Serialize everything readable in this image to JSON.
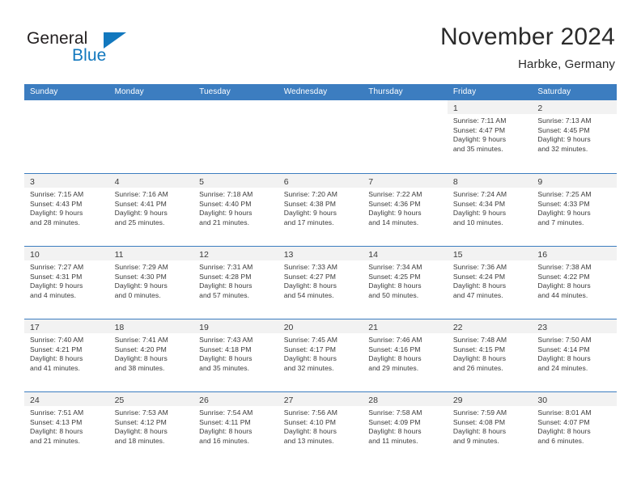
{
  "brand": {
    "name_part1": "General",
    "name_part2": "Blue",
    "triangle_color": "#1278be",
    "text_color": "#231f20"
  },
  "header": {
    "title": "November 2024",
    "subtitle": "Harbke, Germany"
  },
  "theme": {
    "header_blue": "#3c7dc0",
    "daynum_strip": "#f2f2f2",
    "text": "#3a3a3a"
  },
  "weekdays": [
    "Sunday",
    "Monday",
    "Tuesday",
    "Wednesday",
    "Thursday",
    "Friday",
    "Saturday"
  ],
  "weeks": [
    [
      {
        "day": "",
        "lines": [
          "",
          "",
          "",
          ""
        ]
      },
      {
        "day": "",
        "lines": [
          "",
          "",
          "",
          ""
        ]
      },
      {
        "day": "",
        "lines": [
          "",
          "",
          "",
          ""
        ]
      },
      {
        "day": "",
        "lines": [
          "",
          "",
          "",
          ""
        ]
      },
      {
        "day": "",
        "lines": [
          "",
          "",
          "",
          ""
        ]
      },
      {
        "day": "1",
        "lines": [
          "Sunrise: 7:11 AM",
          "Sunset: 4:47 PM",
          "Daylight: 9 hours",
          "and 35 minutes."
        ]
      },
      {
        "day": "2",
        "lines": [
          "Sunrise: 7:13 AM",
          "Sunset: 4:45 PM",
          "Daylight: 9 hours",
          "and 32 minutes."
        ]
      }
    ],
    [
      {
        "day": "3",
        "lines": [
          "Sunrise: 7:15 AM",
          "Sunset: 4:43 PM",
          "Daylight: 9 hours",
          "and 28 minutes."
        ]
      },
      {
        "day": "4",
        "lines": [
          "Sunrise: 7:16 AM",
          "Sunset: 4:41 PM",
          "Daylight: 9 hours",
          "and 25 minutes."
        ]
      },
      {
        "day": "5",
        "lines": [
          "Sunrise: 7:18 AM",
          "Sunset: 4:40 PM",
          "Daylight: 9 hours",
          "and 21 minutes."
        ]
      },
      {
        "day": "6",
        "lines": [
          "Sunrise: 7:20 AM",
          "Sunset: 4:38 PM",
          "Daylight: 9 hours",
          "and 17 minutes."
        ]
      },
      {
        "day": "7",
        "lines": [
          "Sunrise: 7:22 AM",
          "Sunset: 4:36 PM",
          "Daylight: 9 hours",
          "and 14 minutes."
        ]
      },
      {
        "day": "8",
        "lines": [
          "Sunrise: 7:24 AM",
          "Sunset: 4:34 PM",
          "Daylight: 9 hours",
          "and 10 minutes."
        ]
      },
      {
        "day": "9",
        "lines": [
          "Sunrise: 7:25 AM",
          "Sunset: 4:33 PM",
          "Daylight: 9 hours",
          "and 7 minutes."
        ]
      }
    ],
    [
      {
        "day": "10",
        "lines": [
          "Sunrise: 7:27 AM",
          "Sunset: 4:31 PM",
          "Daylight: 9 hours",
          "and 4 minutes."
        ]
      },
      {
        "day": "11",
        "lines": [
          "Sunrise: 7:29 AM",
          "Sunset: 4:30 PM",
          "Daylight: 9 hours",
          "and 0 minutes."
        ]
      },
      {
        "day": "12",
        "lines": [
          "Sunrise: 7:31 AM",
          "Sunset: 4:28 PM",
          "Daylight: 8 hours",
          "and 57 minutes."
        ]
      },
      {
        "day": "13",
        "lines": [
          "Sunrise: 7:33 AM",
          "Sunset: 4:27 PM",
          "Daylight: 8 hours",
          "and 54 minutes."
        ]
      },
      {
        "day": "14",
        "lines": [
          "Sunrise: 7:34 AM",
          "Sunset: 4:25 PM",
          "Daylight: 8 hours",
          "and 50 minutes."
        ]
      },
      {
        "day": "15",
        "lines": [
          "Sunrise: 7:36 AM",
          "Sunset: 4:24 PM",
          "Daylight: 8 hours",
          "and 47 minutes."
        ]
      },
      {
        "day": "16",
        "lines": [
          "Sunrise: 7:38 AM",
          "Sunset: 4:22 PM",
          "Daylight: 8 hours",
          "and 44 minutes."
        ]
      }
    ],
    [
      {
        "day": "17",
        "lines": [
          "Sunrise: 7:40 AM",
          "Sunset: 4:21 PM",
          "Daylight: 8 hours",
          "and 41 minutes."
        ]
      },
      {
        "day": "18",
        "lines": [
          "Sunrise: 7:41 AM",
          "Sunset: 4:20 PM",
          "Daylight: 8 hours",
          "and 38 minutes."
        ]
      },
      {
        "day": "19",
        "lines": [
          "Sunrise: 7:43 AM",
          "Sunset: 4:18 PM",
          "Daylight: 8 hours",
          "and 35 minutes."
        ]
      },
      {
        "day": "20",
        "lines": [
          "Sunrise: 7:45 AM",
          "Sunset: 4:17 PM",
          "Daylight: 8 hours",
          "and 32 minutes."
        ]
      },
      {
        "day": "21",
        "lines": [
          "Sunrise: 7:46 AM",
          "Sunset: 4:16 PM",
          "Daylight: 8 hours",
          "and 29 minutes."
        ]
      },
      {
        "day": "22",
        "lines": [
          "Sunrise: 7:48 AM",
          "Sunset: 4:15 PM",
          "Daylight: 8 hours",
          "and 26 minutes."
        ]
      },
      {
        "day": "23",
        "lines": [
          "Sunrise: 7:50 AM",
          "Sunset: 4:14 PM",
          "Daylight: 8 hours",
          "and 24 minutes."
        ]
      }
    ],
    [
      {
        "day": "24",
        "lines": [
          "Sunrise: 7:51 AM",
          "Sunset: 4:13 PM",
          "Daylight: 8 hours",
          "and 21 minutes."
        ]
      },
      {
        "day": "25",
        "lines": [
          "Sunrise: 7:53 AM",
          "Sunset: 4:12 PM",
          "Daylight: 8 hours",
          "and 18 minutes."
        ]
      },
      {
        "day": "26",
        "lines": [
          "Sunrise: 7:54 AM",
          "Sunset: 4:11 PM",
          "Daylight: 8 hours",
          "and 16 minutes."
        ]
      },
      {
        "day": "27",
        "lines": [
          "Sunrise: 7:56 AM",
          "Sunset: 4:10 PM",
          "Daylight: 8 hours",
          "and 13 minutes."
        ]
      },
      {
        "day": "28",
        "lines": [
          "Sunrise: 7:58 AM",
          "Sunset: 4:09 PM",
          "Daylight: 8 hours",
          "and 11 minutes."
        ]
      },
      {
        "day": "29",
        "lines": [
          "Sunrise: 7:59 AM",
          "Sunset: 4:08 PM",
          "Daylight: 8 hours",
          "and 9 minutes."
        ]
      },
      {
        "day": "30",
        "lines": [
          "Sunrise: 8:01 AM",
          "Sunset: 4:07 PM",
          "Daylight: 8 hours",
          "and 6 minutes."
        ]
      }
    ]
  ]
}
